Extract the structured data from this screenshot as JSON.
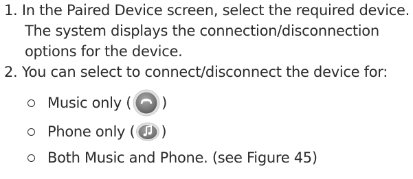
{
  "steps": [
    {
      "number": "1.",
      "line1": "In the Paired Device screen, select the required device.",
      "line2": "The system displays the connection/disconnection",
      "line3": "options for the device."
    },
    {
      "number": "2.",
      "line1": "You can select to connect/disconnect the device for:"
    }
  ],
  "options": [
    {
      "label_before": "Music only (",
      "label_after": ")",
      "icon": "phone-handset-icon"
    },
    {
      "label_before": "Phone only (",
      "label_after": ")",
      "icon": "music-note-icon"
    },
    {
      "label": "Both Music and Phone. (see Figure 45)"
    }
  ],
  "colors": {
    "text": "#2a2a2a",
    "icon_fill": "#8a8a8a",
    "icon_rim": "#d6d6d6"
  }
}
